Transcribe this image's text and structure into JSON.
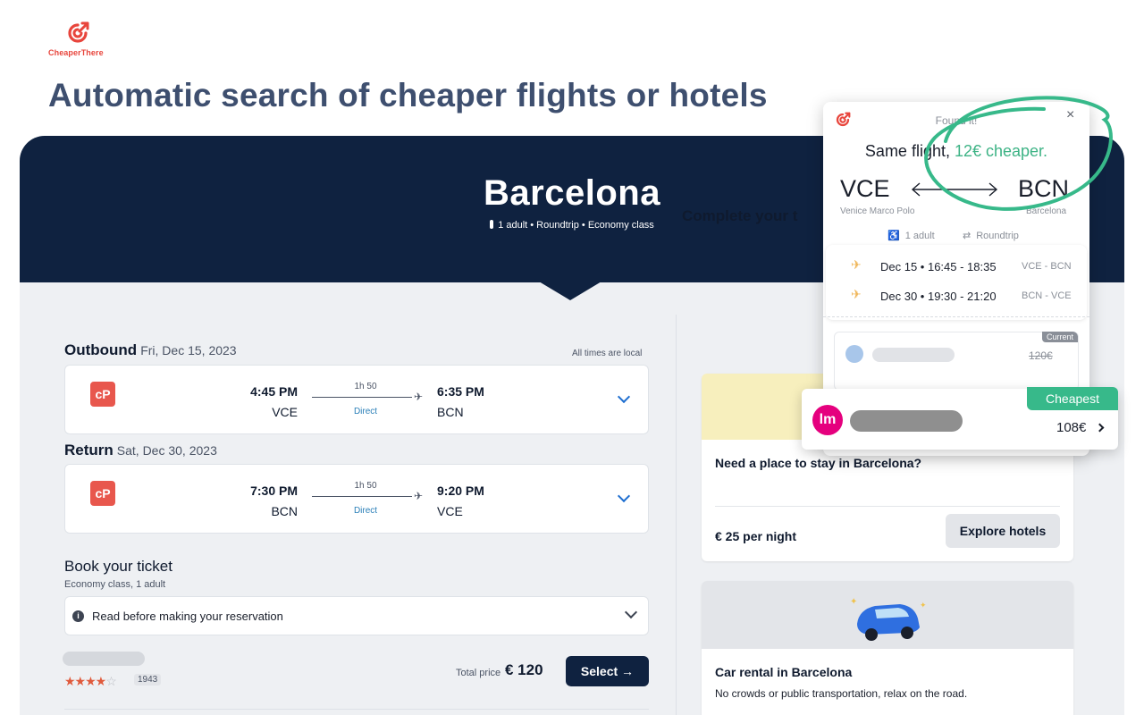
{
  "brand": {
    "name": "CheaperThere",
    "color": "#e8453c"
  },
  "headline": "Automatic search of cheaper flights or hotels",
  "hero": {
    "city": "Barcelona",
    "meta": "1 adult • Roundtrip • Economy class"
  },
  "outbound": {
    "label": "Outbound",
    "date": "Fri, Dec 15, 2023",
    "times_note": "All times are local",
    "dep_time": "4:45 PM",
    "dep_code": "VCE",
    "duration": "1h 50",
    "stops": "Direct",
    "arr_time": "6:35 PM",
    "arr_code": "BCN",
    "airline_logo_text": "cP"
  },
  "return": {
    "label": "Return",
    "date": "Sat, Dec 30, 2023",
    "dep_time": "7:30 PM",
    "dep_code": "BCN",
    "duration": "1h 50",
    "stops": "Direct",
    "arr_time": "9:20 PM",
    "arr_code": "VCE",
    "airline_logo_text": "cP"
  },
  "booking": {
    "title": "Book your ticket",
    "subtitle": "Economy class, 1 adult",
    "info": "Read before making your reservation",
    "rating_stars": 3.5,
    "review_count": "1943",
    "total_label": "Total price",
    "total_value": "€ 120",
    "select_label": "Select →"
  },
  "right": {
    "complete_title": "Complete your t",
    "hotel_question": "Need a place to stay in Barcelona?",
    "hotel_price": "€ 25 per night",
    "explore_label": "Explore hotels",
    "car_title": "Car rental in Barcelona",
    "car_subtitle": "No crowds or public transportation, relax on the road."
  },
  "popup": {
    "found": "Found it!",
    "close": "×",
    "headline_prefix": "Same flight, ",
    "headline_saving": "12€ cheaper.",
    "from_code": "VCE",
    "to_code": "BCN",
    "from_name": "Venice Marco Polo",
    "to_name": "Barcelona",
    "passengers": "1 adult",
    "trip_type": "Roundtrip",
    "legs": [
      {
        "date": "Dec 15 • 16:45 - 18:35",
        "route": "VCE - BCN"
      },
      {
        "date": "Dec 30 • 19:30 - 21:20",
        "route": "BCN - VCE"
      }
    ],
    "current_badge": "Current",
    "current_price": "120€",
    "cheapest_badge": "Cheapest",
    "cheapest_logo": "lm",
    "cheapest_price": "108€",
    "accent": "#3db385"
  },
  "colors": {
    "navy": "#0f2240",
    "headline": "#3e4f6f",
    "green": "#37b98a"
  }
}
